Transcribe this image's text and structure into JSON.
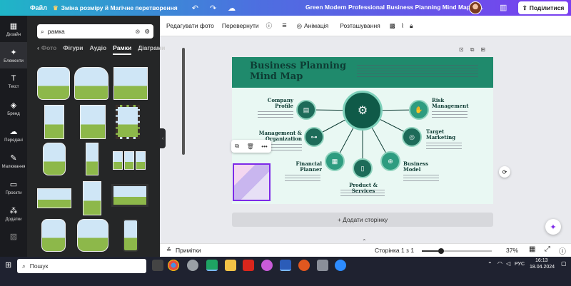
{
  "topbar": {
    "file_menu": "Файл",
    "sync_label": "Зміна розміру й Магічне перетворення",
    "doc_title": "Green Modern Professional Business Planning Mind Map Br...",
    "share_label": "Поділитися"
  },
  "rail": [
    {
      "icon": "layout-icon",
      "label": "Дизайн"
    },
    {
      "icon": "elements-icon",
      "label": "Елементи"
    },
    {
      "icon": "text-icon",
      "label": "Текст"
    },
    {
      "icon": "brand-icon",
      "label": "Бренд"
    },
    {
      "icon": "upload-icon",
      "label": "Передані"
    },
    {
      "icon": "draw-icon",
      "label": "Малювання"
    },
    {
      "icon": "folder-icon",
      "label": "Проєкти"
    },
    {
      "icon": "apps-icon",
      "label": "Додатки"
    }
  ],
  "panel": {
    "search_value": "рамка",
    "tabs": [
      "Фото",
      "Фігури",
      "Аудіо",
      "Рамки",
      "Діаграми"
    ],
    "active_tab": "Рамки"
  },
  "context_toolbar": {
    "edit_photo": "Редагувати фото",
    "flip": "Перевернути",
    "animation": "Анімація",
    "position": "Розташування"
  },
  "design": {
    "title": "Business Planning Mind Map",
    "nodes": [
      {
        "name": "node-company-profile",
        "label": "Company Profile"
      },
      {
        "name": "node-management",
        "label": "Management & Organization"
      },
      {
        "name": "node-financial-planner",
        "label": "Financial Planner"
      },
      {
        "name": "node-product-services",
        "label": "Product & Services"
      },
      {
        "name": "node-business-model",
        "label": "Business Model"
      },
      {
        "name": "node-target-marketing",
        "label": "Target Marketing"
      },
      {
        "name": "node-risk-management",
        "label": "Risk Management"
      }
    ]
  },
  "add_page": "+ Додати сторінку",
  "bottombar": {
    "notes": "Примітки",
    "page_indicator": "Сторінка 1 з 1",
    "zoom": "37%",
    "zoom_fraction": 0.28
  },
  "taskbar": {
    "search_placeholder": "Пошук",
    "lang": "РУС",
    "time": "16:13",
    "date": "18.04.2024"
  }
}
